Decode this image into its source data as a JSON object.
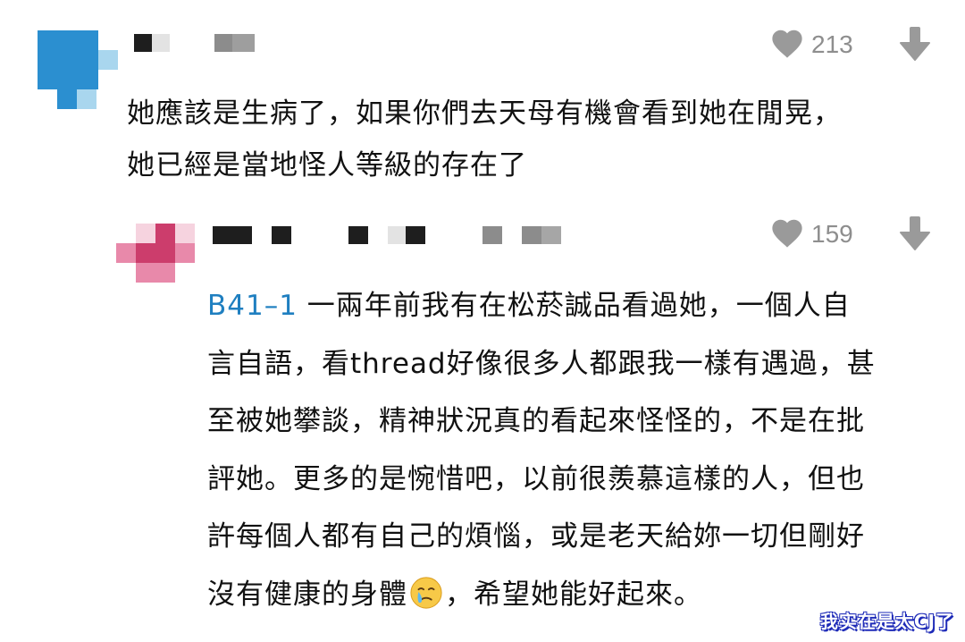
{
  "comments": [
    {
      "likes": "213",
      "lines": [
        "她應該是生病了，如果你們去天母有機會看到她在閒晃，",
        "她已經是當地怪人等級的存在了"
      ]
    },
    {
      "likes": "159",
      "mention": "B41–1",
      "lines": [
        " 一兩年前我有在松菸誠品看過她，一個人自",
        "言自語，看thread好像很多人都跟我一樣有遇過，甚",
        "至被她攀談，精神狀況真的看起來怪怪的，不是在批",
        "評她。更多的是惋惜吧，以前很羨慕這樣的人，但也",
        "許每個人都有自己的煩惱，或是老天給妳一切但剛好"
      ],
      "last_line_before_emoji": "沒有健康的身體",
      "last_line_after_emoji": "，希望她能好起來。",
      "emoji": "crying-face"
    }
  ],
  "watermark": "我实在是太CJ了",
  "colors": {
    "avatar1_dark": "#2b8fd0",
    "avatar1_light": "#a9d6ee",
    "avatar2_dark": "#cc3d6c",
    "avatar2_mid": "#e889aa",
    "avatar2_light": "#f6d3df",
    "mention": "#1f7fc0",
    "icon_gray": "#9a9a9a"
  }
}
